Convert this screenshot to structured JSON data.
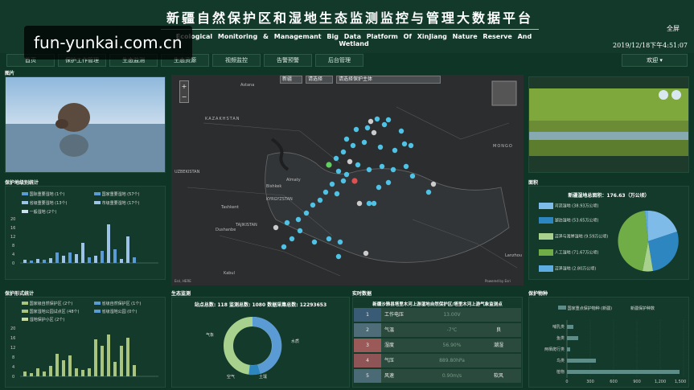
{
  "header": {
    "title": "新疆自然保护区和湿地生态监测监控与管理大数据平台",
    "subtitle_en": "Ecological Monitoring & Managemant Big Data Platform Of XinJiang Nature Reserve And Wetland",
    "fullscreen_label": "全屏",
    "datetime": "2019/12/18下午4:51:07"
  },
  "watermark": "fun-yunkai.com.cn",
  "nav": {
    "items": [
      "首页",
      "保护工作管理",
      "生态监测",
      "生态资源",
      "视频监控",
      "告警预警",
      "后台管理"
    ],
    "welcome": "欢迎 ▾"
  },
  "left_top": {
    "label": "图片"
  },
  "reserve_stats": {
    "label": "保护地级别统计",
    "legend": [
      "国际重要湿地 (1个)",
      "国家重要湿地 (57个)",
      "省级重要湿地 (13个)",
      "市级重要湿地 (17个)",
      "一般湿地 (2个)"
    ],
    "y_ticks": [
      "20",
      "16",
      "12",
      "8",
      "4",
      "0"
    ]
  },
  "reserve_type_stats": {
    "label": "保护形式统计",
    "legend": [
      "国家级自然保护区 (2个)",
      "省级自然保护区 (1个)",
      "国家湿地公园试点区 (48个)",
      "省级湿地公园 (0个)",
      "湿地保护小区 (2个)"
    ],
    "y_ticks": [
      "20",
      "16",
      "12",
      "8",
      "4",
      "0"
    ]
  },
  "map": {
    "selects": [
      "新疆",
      "请选择",
      "请选择保护主体"
    ],
    "zoom_in": "+",
    "zoom_out": "−",
    "labels": [
      "Astana",
      "KAZAKHSTAN",
      "Bishkek",
      "Almaty",
      "KYRGYZSTAN",
      "Tashkent",
      "UZBEKISTAN",
      "Dushanbe",
      "TAJIKISTAN",
      "Kabul",
      "MONGO",
      "Lanzhou"
    ],
    "attribution": "Esri, HERE",
    "powered": "Powered by Esri"
  },
  "eco_monitor": {
    "label": "生态监测",
    "stats": "站点总数: 118   监测总数: 1080   数据采集总数: 12293653",
    "donut_labels": [
      "气象",
      "水质",
      "土壤",
      "空气"
    ]
  },
  "realtime": {
    "label": "实时数据",
    "caption": "新疆沙雅县塔里木河上游湿地自然保护区/塔里木河上游气象监测点",
    "rows": [
      {
        "no": "1",
        "name": "工作电压",
        "value": "13.00V",
        "unit": ""
      },
      {
        "no": "2",
        "name": "气温",
        "value": "-7℃",
        "unit": "良"
      },
      {
        "no": "3",
        "name": "湿度",
        "value": "56.90%",
        "unit": "潮湿"
      },
      {
        "no": "4",
        "name": "气压",
        "value": "889.80hPa",
        "unit": ""
      },
      {
        "no": "5",
        "name": "风速",
        "value": "0.90m/s",
        "unit": "软风"
      }
    ]
  },
  "wetland": {
    "label": "面积",
    "title": "新疆湿地总面积：176.63（万公顷）",
    "legend": [
      "河流湿地 (38.93万公顷)",
      "湖泊湿地 (53.65万公顷)",
      "沼泽与海岸湿地 (9.59万公顷)",
      "人工湿地 (71.67万公顷)",
      "沼泽湿地 (2.80万公顷)"
    ]
  },
  "species": {
    "label": "保护物种",
    "legend": [
      "国家重点保护物种 (新疆)",
      "新疆保护种数"
    ],
    "categories": [
      "哺乳类",
      "鱼类",
      "两栖爬行类",
      "鸟类",
      "植物"
    ],
    "x_ticks": [
      "0",
      "300",
      "600",
      "900",
      "1,200",
      "1,500"
    ]
  },
  "colors": {
    "bg": "#0f3526",
    "panel": "#143a2c",
    "bar_blue": "#5b9bd5",
    "bar_light": "#9dc3e6",
    "bar_green": "#a9c47f",
    "pie": [
      "#7fbbe8",
      "#2e86c1",
      "#a9d18e",
      "#70ad47",
      "#5dade2"
    ],
    "row_colors": [
      "#3a5b76",
      "#4f6d78",
      "#9b5a57",
      "#8f5556",
      "#4a6b76"
    ]
  }
}
